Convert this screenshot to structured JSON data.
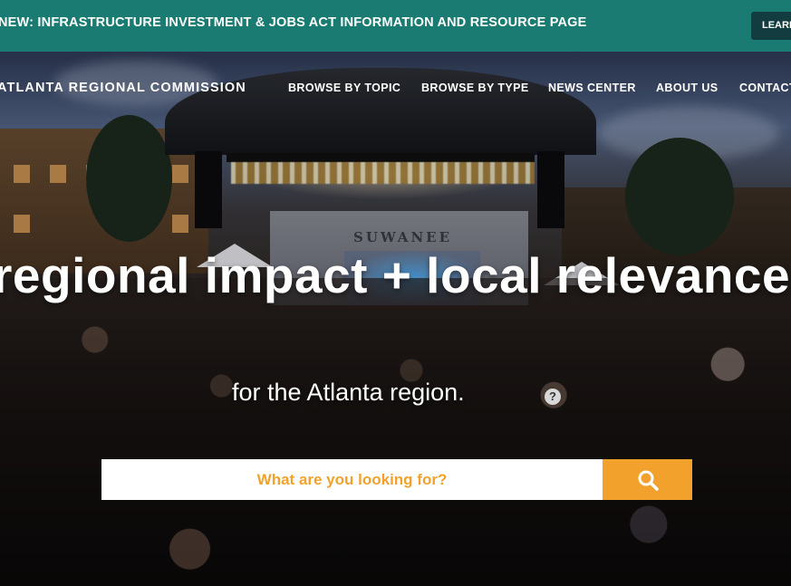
{
  "announcement": {
    "text": "NEW: INFRASTRUCTURE INVESTMENT & JOBS ACT INFORMATION AND RESOURCE PAGE",
    "button_label": "LEARN"
  },
  "header": {
    "logo_text": "ATLANTA REGIONAL COMMISSION",
    "nav": [
      {
        "label": "BROWSE BY TOPIC"
      },
      {
        "label": "BROWSE BY TYPE"
      },
      {
        "label": "NEWS CENTER"
      },
      {
        "label": "ABOUT US"
      },
      {
        "label": "CONTACT"
      }
    ]
  },
  "hero": {
    "stage_sign": "SUWANEE",
    "headline": "regional impact + local relevance",
    "subheadline": "for the Atlanta region.",
    "help_icon": "question-icon"
  },
  "search": {
    "placeholder": "What are you looking for?",
    "button_icon": "search-icon"
  },
  "colors": {
    "announcement_bg": "#1a7b73",
    "button_dark": "#123c3f",
    "accent_orange": "#f2a22c"
  }
}
